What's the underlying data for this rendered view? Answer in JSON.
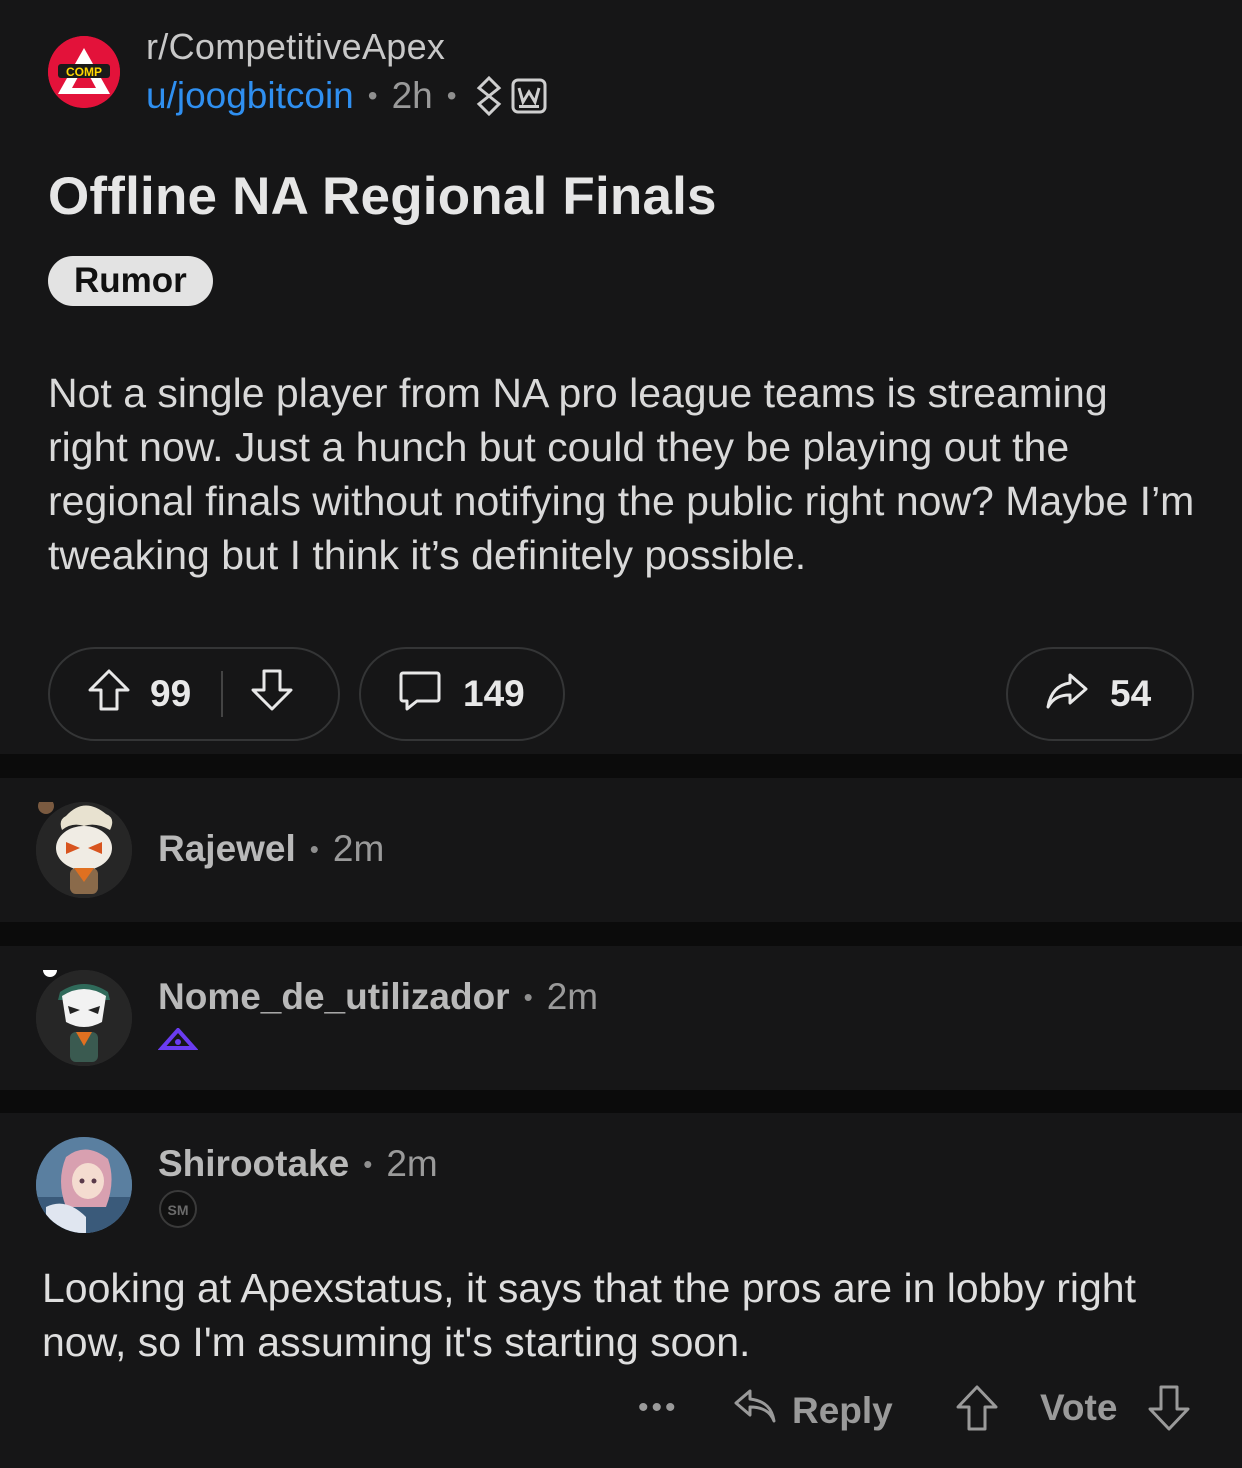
{
  "post": {
    "subreddit": "r/CompetitiveApex",
    "subreddit_icon_text": "COMP",
    "author": "u/joogbitcoin",
    "age": "2h",
    "separator": "•",
    "award_icons": [
      "link-chain-icon",
      "w-award-icon"
    ],
    "title": "Offline NA Regional Finals",
    "flair": "Rumor",
    "body": "Not a single player from NA pro league teams is streaming right now. Just a hunch but could they be playing out the regional finals without notifying the public right now? Maybe I’m tweaking but I think it’s definitely possible.",
    "upvotes": "99",
    "comments": "149",
    "shares": "54"
  },
  "comments": [
    {
      "author": "Rajewel",
      "age": "2m",
      "avatar": "snoo-avatar-white-hair"
    },
    {
      "author": "Nome_de_utilizador",
      "age": "2m",
      "avatar": "snoo-avatar-mask",
      "flair_icon": "team-logo-purple-icon"
    },
    {
      "author": "Shirootake",
      "age": "2m",
      "avatar": "anime-girl-avatar",
      "flair_icon": "tsm-logo-icon",
      "body": "Looking at Apexstatus, it says that the pros are in lobby right now, so I'm assuming it's starting soon.",
      "actions": {
        "more": "•••",
        "reply": "Reply",
        "vote": "Vote"
      }
    }
  ],
  "colors": {
    "background": "#0b0b0b",
    "card": "#161617",
    "link_blue": "#2f8ff0",
    "subreddit_red": "#e3123a",
    "flair_bg": "#e3e3e3"
  }
}
